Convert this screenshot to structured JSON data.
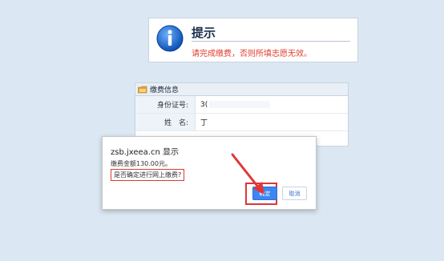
{
  "notice": {
    "title": "提示",
    "message": "请完成缴费，否则所填志愿无效。",
    "icon": "info-icon"
  },
  "panel": {
    "header": "缴费信息",
    "rows": [
      {
        "label": "身份证号:",
        "value": "3("
      },
      {
        "label": "姓　名:",
        "value": "丁"
      }
    ]
  },
  "dialog": {
    "title": "zsb.jxeea.cn 显示",
    "amount_text": "缴费金额130.00元。",
    "confirm_question": "是否确定进行网上缴费?",
    "ok_label": "确定",
    "cancel_label": "取消"
  },
  "colors": {
    "background": "#dbe8f3",
    "accent_blue": "#3d86f3",
    "warning_red": "#e23b2e",
    "annotation_red": "#e03636"
  }
}
